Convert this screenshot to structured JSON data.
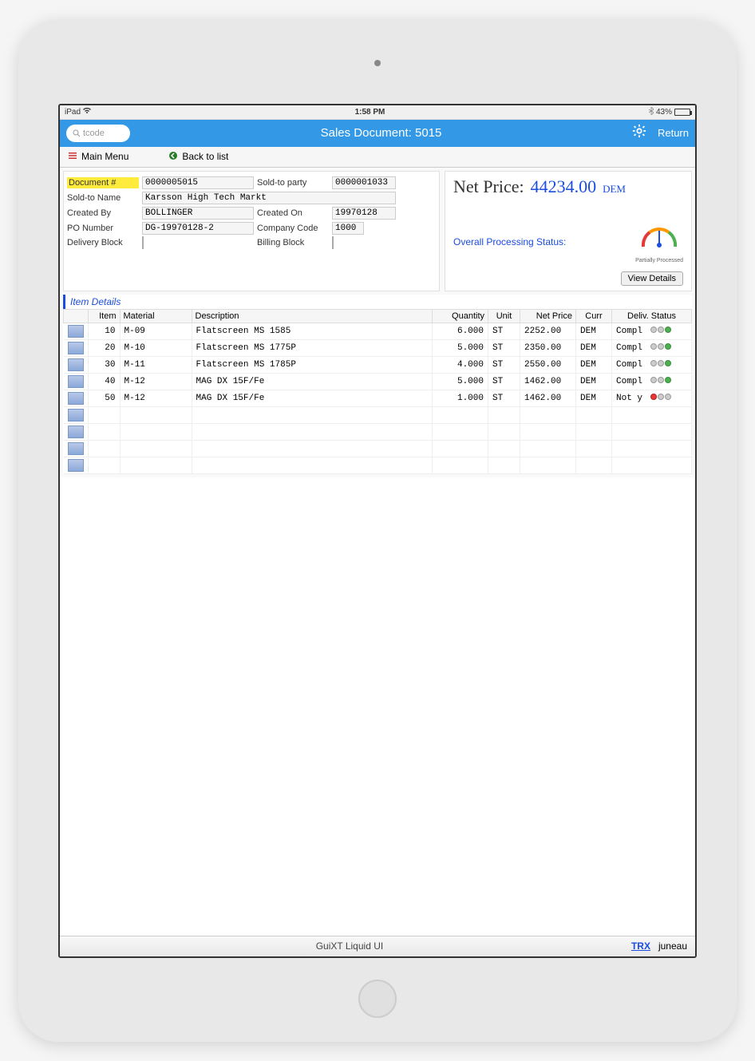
{
  "status_bar": {
    "device": "iPad",
    "time": "1:58 PM",
    "battery_pct": "43%"
  },
  "title_bar": {
    "search_placeholder": "tcode",
    "title": "Sales Document: 5015",
    "return_label": "Return"
  },
  "nav": {
    "main_menu": "Main Menu",
    "back_to_list": "Back to list"
  },
  "form": {
    "labels": {
      "document_no": "Document #",
      "sold_to_party": "Sold-to party",
      "sold_to_name": "Sold-to Name",
      "created_by": "Created By",
      "created_on": "Created On",
      "po_number": "PO Number",
      "company_code": "Company Code",
      "delivery_block": "Delivery Block",
      "billing_block": "Billing Block"
    },
    "values": {
      "document_no": "0000005015",
      "sold_to_party": "0000001033",
      "sold_to_name": "Karsson High Tech Markt",
      "created_by": "BOLLINGER",
      "created_on": "19970128",
      "po_number": "DG-19970128-2",
      "company_code": "1000"
    }
  },
  "price_panel": {
    "net_price_label": "Net Price:",
    "net_price_value": "44234.00",
    "net_price_curr": "DEM",
    "status_label": "Overall Processing Status:",
    "gauge_caption": "Partially Processed",
    "view_details": "View Details"
  },
  "item_details": {
    "section_title": "Item Details",
    "headers": [
      "Item",
      "Material",
      "Description",
      "Quantity",
      "Unit",
      "Net Price",
      "Curr",
      "Deliv. Status"
    ],
    "rows": [
      {
        "item": "10",
        "material": "M-09",
        "desc": "Flatscreen MS 1585",
        "qty": "6.000",
        "unit": "ST",
        "price": "2252.00",
        "curr": "DEM",
        "status": "Compl",
        "lights": "green"
      },
      {
        "item": "20",
        "material": "M-10",
        "desc": "Flatscreen MS 1775P",
        "qty": "5.000",
        "unit": "ST",
        "price": "2350.00",
        "curr": "DEM",
        "status": "Compl",
        "lights": "green"
      },
      {
        "item": "30",
        "material": "M-11",
        "desc": "Flatscreen MS 1785P",
        "qty": "4.000",
        "unit": "ST",
        "price": "2550.00",
        "curr": "DEM",
        "status": "Compl",
        "lights": "green"
      },
      {
        "item": "40",
        "material": "M-12",
        "desc": "MAG DX 15F/Fe",
        "qty": "5.000",
        "unit": "ST",
        "price": "1462.00",
        "curr": "DEM",
        "status": "Compl",
        "lights": "green"
      },
      {
        "item": "50",
        "material": "M-12",
        "desc": "MAG DX 15F/Fe",
        "qty": "1.000",
        "unit": "ST",
        "price": "1462.00",
        "curr": "DEM",
        "status": "Not y",
        "lights": "red"
      }
    ]
  },
  "footer": {
    "center": "GuiXT Liquid UI",
    "trx": "TRX",
    "user": "juneau"
  }
}
